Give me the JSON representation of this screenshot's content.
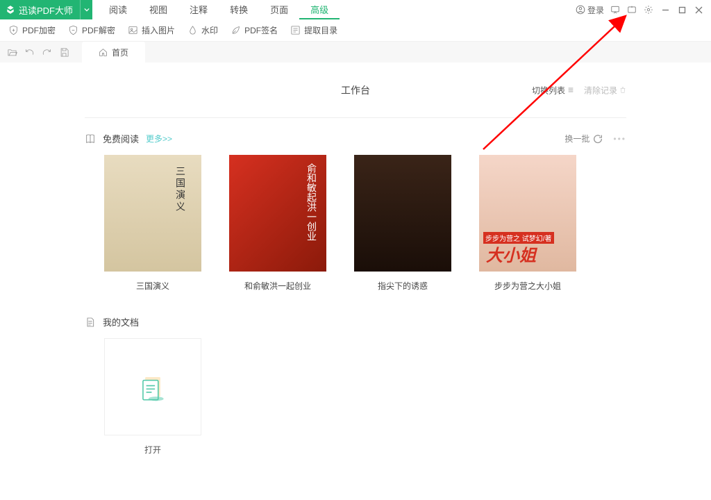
{
  "app": {
    "name": "迅读PDF大师"
  },
  "tabs": [
    {
      "label": "阅读"
    },
    {
      "label": "视图"
    },
    {
      "label": "注释"
    },
    {
      "label": "转换"
    },
    {
      "label": "页面"
    },
    {
      "label": "高级"
    }
  ],
  "login_label": "登录",
  "toolbar": [
    {
      "label": "PDF加密",
      "icon": "shield-plus"
    },
    {
      "label": "PDF解密",
      "icon": "shield-minus"
    },
    {
      "label": "插入图片",
      "icon": "image"
    },
    {
      "label": "水印",
      "icon": "droplet"
    },
    {
      "label": "PDF签名",
      "icon": "leaf"
    },
    {
      "label": "提取目录",
      "icon": "list"
    }
  ],
  "home_tab": "首页",
  "workspace": {
    "title": "工作台",
    "switch_list": "切换列表",
    "clear": "清除记录"
  },
  "free_reading": {
    "title": "免费阅读",
    "more": "更多>>",
    "refresh": "换一批",
    "books": [
      {
        "title": "三国演义"
      },
      {
        "title": "和俞敏洪一起创业"
      },
      {
        "title": "指尖下的诱惑"
      },
      {
        "title": "步步为营之大小姐"
      }
    ]
  },
  "my_docs": {
    "title": "我的文档",
    "open_label": "打开"
  }
}
